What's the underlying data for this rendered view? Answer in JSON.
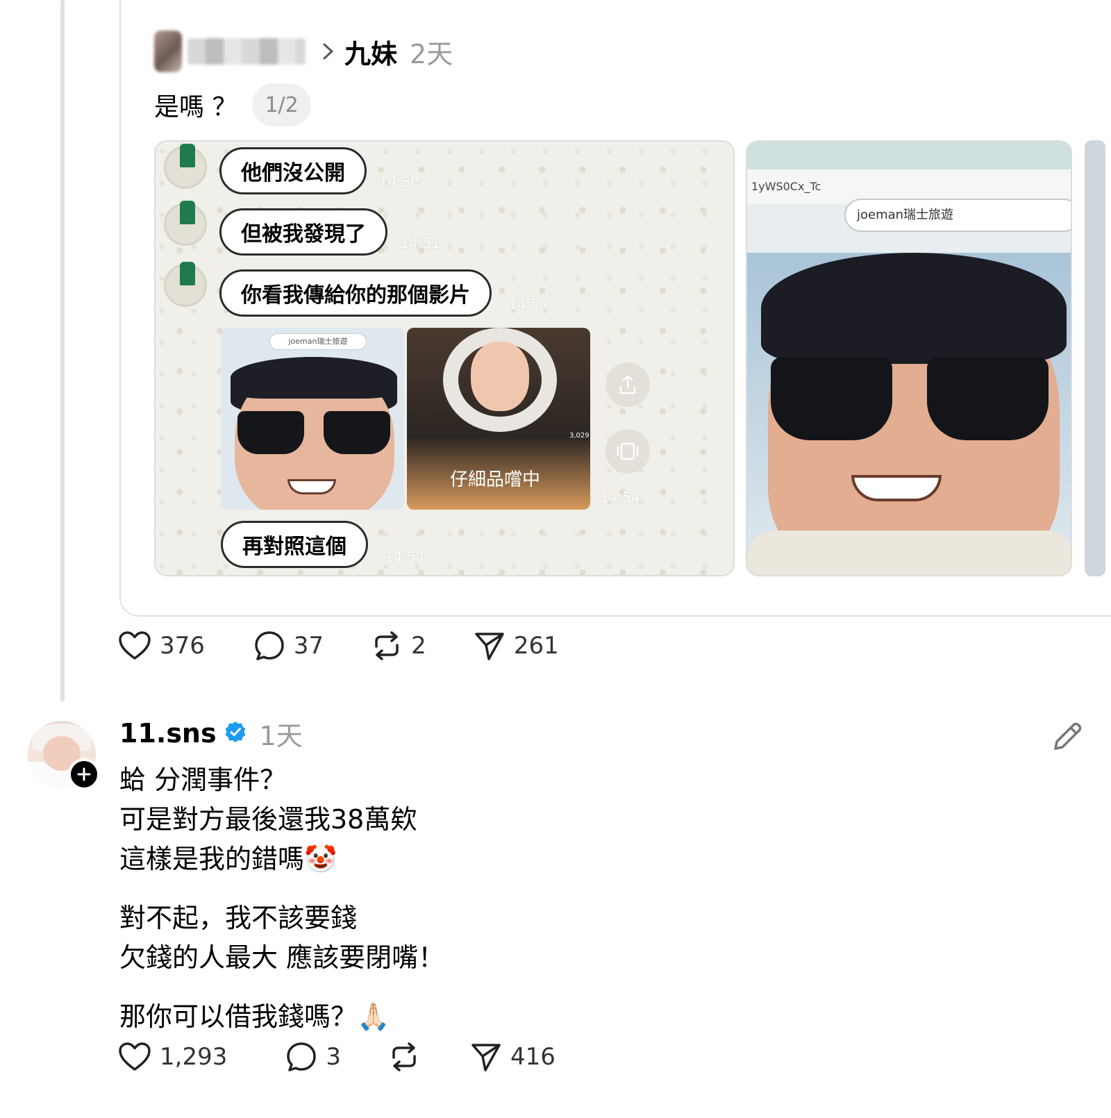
{
  "quoted_post": {
    "author": "九妹",
    "time": "2天",
    "text": "是嗎 ？",
    "page_indicator": "1/2",
    "images": {
      "chat": {
        "messages": [
          {
            "text": "他們沒公開",
            "time": "14:50"
          },
          {
            "text": "但被我發現了",
            "time": "14:51"
          },
          {
            "text": "你看我傳給你的那個影片",
            "time": "14:54"
          },
          {
            "text": "再對照這個",
            "time": "14:54"
          }
        ],
        "thumb_search_label": "joeman瑞士旅遊",
        "video_caption": "仔細品嚐中",
        "video_like_count": "3,029",
        "media_time": "14:54"
      },
      "photo": {
        "url_text": "1yWS0Cx_Tc",
        "search_text": "joeman瑞士旅遊"
      }
    },
    "actions": {
      "likes": "376",
      "comments": "37",
      "reposts": "2",
      "shares": "261"
    }
  },
  "post": {
    "username": "11.sns",
    "verified": true,
    "time": "1天",
    "lines": [
      "蛤 分潤事件？",
      "可是對方最後還我38萬欸",
      "這樣是我的錯嗎🤡",
      "",
      "對不起，我不該要錢",
      "欠錢的人最大 應該要閉嘴！",
      "",
      "那你可以借我錢嗎？🙏🏻"
    ],
    "actions": {
      "likes": "1,293",
      "comments": "3",
      "reposts": "",
      "shares": "416"
    }
  },
  "colors": {
    "verified_blue": "#1d9bf0",
    "muted_text": "#9a9a9a",
    "thread_line": "#e1e1e1"
  }
}
